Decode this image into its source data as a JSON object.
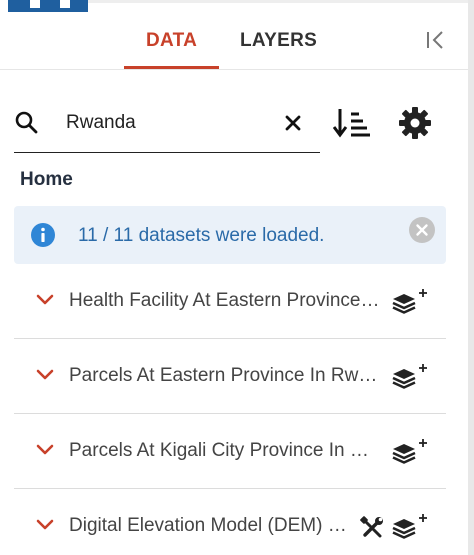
{
  "tabs": {
    "data": "DATA",
    "layers": "LAYERS"
  },
  "search": {
    "value": "Rwanda",
    "placeholder": ""
  },
  "breadcrumb": "Home",
  "info": {
    "message": "11 / 11 datasets were loaded."
  },
  "datasets": [
    {
      "title": "Health Facility At Eastern Province In Rwanda"
    },
    {
      "title": "Parcels At Eastern Province In Rwanda"
    },
    {
      "title": "Parcels At Kigali City Province In Rwanda"
    },
    {
      "title": "Digital Elevation Model (DEM) For Rwanda"
    }
  ],
  "icons": {
    "search": "search-icon",
    "clear": "close-icon",
    "sort": "sort-icon",
    "settings": "gear-icon",
    "collapse": "collapse-panel-icon",
    "info": "info-icon",
    "dismiss": "close-circle-icon",
    "expand": "chevron-down-icon",
    "add_layer": "layers-plus-icon",
    "tools": "tools-icon"
  },
  "colors": {
    "accent": "#c8412a",
    "info_bg": "#eaf1f9",
    "info_text": "#2a6aa8"
  }
}
